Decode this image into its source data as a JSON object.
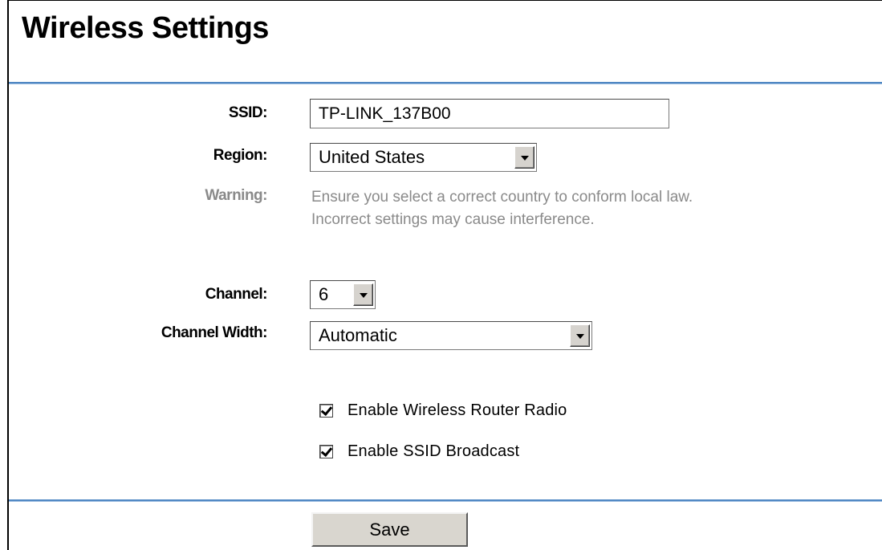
{
  "page": {
    "title": "Wireless Settings"
  },
  "form": {
    "ssid": {
      "label": "SSID:",
      "value": "TP-LINK_137B00"
    },
    "region": {
      "label": "Region:",
      "value": "United States"
    },
    "warning": {
      "label": "Warning:",
      "line1": "Ensure you select a correct country to conform local law.",
      "line2": "Incorrect settings may cause interference."
    },
    "channel": {
      "label": "Channel:",
      "value": "6"
    },
    "channel_width": {
      "label": "Channel Width:",
      "value": "Automatic"
    },
    "enable_radio": {
      "label": "Enable Wireless Router Radio",
      "checked": true
    },
    "enable_ssid_broadcast": {
      "label": "Enable SSID Broadcast",
      "checked": true
    }
  },
  "actions": {
    "save_label": "Save"
  },
  "colors": {
    "rule": "#4f87c3",
    "muted_text": "#8a8a8a",
    "button_face": "#d9d6cf"
  },
  "icons": {
    "dropdown": "chevron-down-icon",
    "checkbox": "checkmark-icon"
  }
}
